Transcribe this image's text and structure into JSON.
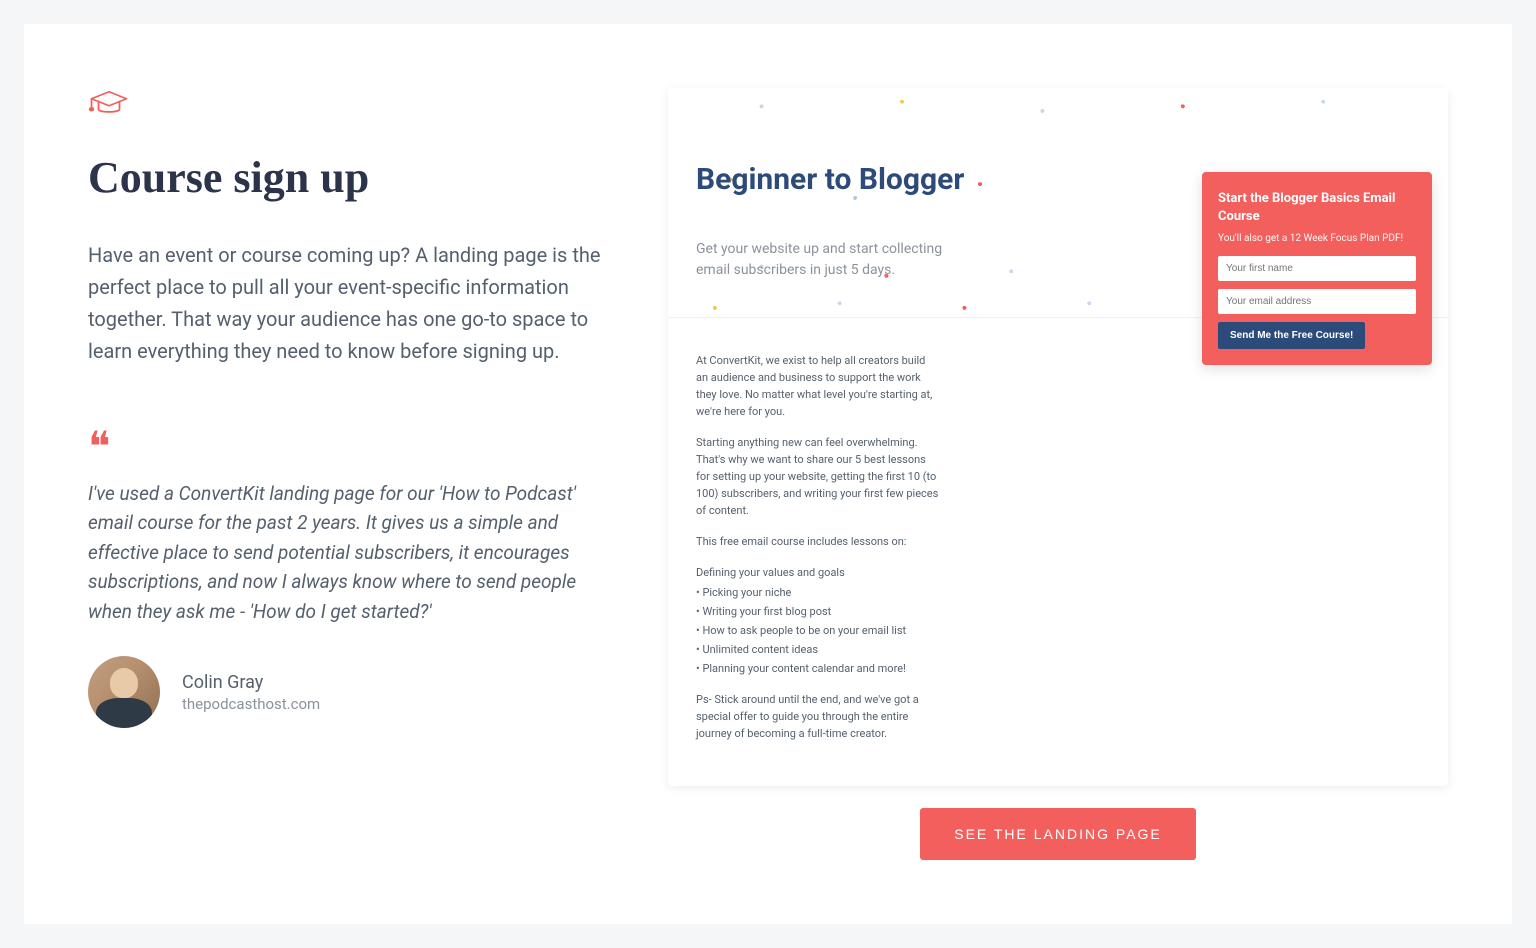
{
  "left": {
    "title": "Course sign up",
    "description": "Have an event or course coming up? A landing page is the perfect place to pull all your event-specific information together. That way your audience has one go-to space to learn everything they need to know before signing up.",
    "quote": "I've used a ConvertKit landing page for our 'How to Podcast' email course for the past 2 years. It gives us a simple and effective place to send potential subscribers, it encourages subscriptions, and now I always know where to send people when they ask me - 'How do I get started?'",
    "author_name": "Colin Gray",
    "author_site": "thepodcasthost.com"
  },
  "preview": {
    "hero_title": "Beginner to Blogger",
    "hero_sub": "Get your website up and start collecting email subscribers in just 5 days.",
    "form_title": "Start the Blogger Basics Email Course",
    "form_sub": "You'll also get a 12 Week Focus Plan PDF!",
    "form_name_ph": "Your first name",
    "form_email_ph": "Your email address",
    "form_button": "Send Me the Free Course!",
    "p1": "At ConvertKit, we exist to help all creators build an audience and business to support the work they love. No matter what level you're starting at, we're here for you.",
    "p2": "Starting anything new can feel overwhelming. That's why we want to share our 5 best lessons for setting up your website, getting the first 10 (to 100) subscribers, and writing your first few pieces of content.",
    "p3": "This free email course includes lessons on:",
    "list_intro": "Defining your values and goals",
    "list1": "• Picking your niche",
    "list2": "• Writing your first blog post",
    "list3": "• How to ask people to be on your email list",
    "list4": "• Unlimited content ideas",
    "list5": "• Planning your content calendar and more!",
    "p4": "Ps- Stick around until the end, and we've got a special offer to guide you through the entire journey of becoming a full-time creator."
  },
  "cta": "SEE THE LANDING PAGE"
}
